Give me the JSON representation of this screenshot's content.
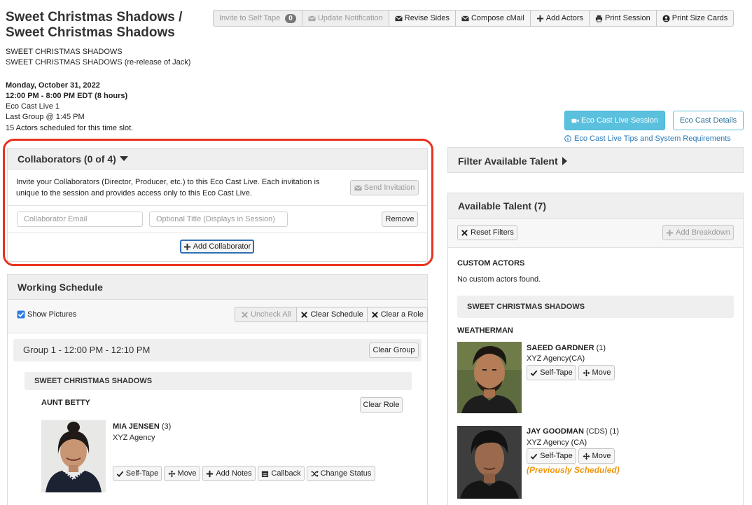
{
  "header": {
    "title_line1": "Sweet Christmas Shadows /",
    "title_line2": "Sweet Christmas Shadows",
    "project_line1": "SWEET CHRISTMAS SHADOWS",
    "project_line2": "SWEET CHRISTMAS SHADOWS (re-release of Jack)",
    "date": "Monday, October 31, 2022",
    "time": "12:00 PM - 8:00 PM EDT (8 hours)",
    "location": "Eco Cast Live 1",
    "last_group": "Last Group @ 1:45 PM",
    "scheduled": "15 Actors scheduled for this time slot."
  },
  "toolbar": {
    "invite_label": "Invite to Self Tape",
    "invite_count": "0",
    "update_label": "Update Notification",
    "revise_label": "Revise Sides",
    "compose_label": "Compose cMail",
    "add_actors_label": "Add Actors",
    "print_session_label": "Print Session",
    "print_cards_label": "Print Size Cards"
  },
  "ecocast": {
    "live_label": "Eco Cast Live Session",
    "details_label": "Eco Cast Details",
    "tips_label": "Eco Cast Live Tips and System Requirements"
  },
  "collaborators": {
    "title": "Collaborators (0 of 4)",
    "description_line1": "Invite your Collaborators (Director, Producer, etc.) to this Eco Cast Live. Each invitation is",
    "description_line2": "unique to the session and provides access only to this Eco Cast Live.",
    "send_label": "Send Invitation",
    "email_placeholder": "Collaborator Email",
    "title_placeholder": "Optional Title (Displays in Session)",
    "remove_label": "Remove",
    "add_label": "Add Collaborator"
  },
  "schedule": {
    "title": "Working Schedule",
    "show_pictures": "Show Pictures",
    "uncheck_label": "Uncheck All",
    "clear_schedule_label": "Clear Schedule",
    "clear_role_label": "Clear a Role",
    "group_label": "Group 1 - 12:00 PM - 12:10 PM",
    "clear_group_label": "Clear Group",
    "project": "SWEET CHRISTMAS SHADOWS",
    "role": "AUNT BETTY",
    "clear_role_btn": "Clear Role",
    "actor": {
      "name": "MIA JENSEN",
      "count": "(3)",
      "agency": "XYZ Agency",
      "actions": [
        "Self-Tape",
        "Move",
        "Add Notes",
        "Callback",
        "Change Status"
      ]
    }
  },
  "filter": {
    "title": "Filter Available Talent"
  },
  "talent": {
    "title": "Available Talent (7)",
    "reset_label": "Reset Filters",
    "add_breakdown_label": "Add Breakdown",
    "custom_heading": "CUSTOM ACTORS",
    "custom_empty": "No custom actors found.",
    "project": "SWEET CHRISTMAS SHADOWS",
    "role": "WEATHERMAN",
    "actors": [
      {
        "name": "SAEED GARDNER",
        "suffix": "(1)",
        "agency": "XYZ Agency(CA)",
        "note": ""
      },
      {
        "name": "JAY GOODMAN",
        "suffix": "(CDS) (1)",
        "agency": "XYZ Agency (CA)",
        "note": "(Previously Scheduled)"
      }
    ],
    "action_selftape": "Self-Tape",
    "action_move": "Move"
  },
  "colors": {
    "accent": "#5bc0de",
    "highlight": "#e8321f",
    "warning": "#f0960e",
    "link": "#2a7ab8"
  }
}
